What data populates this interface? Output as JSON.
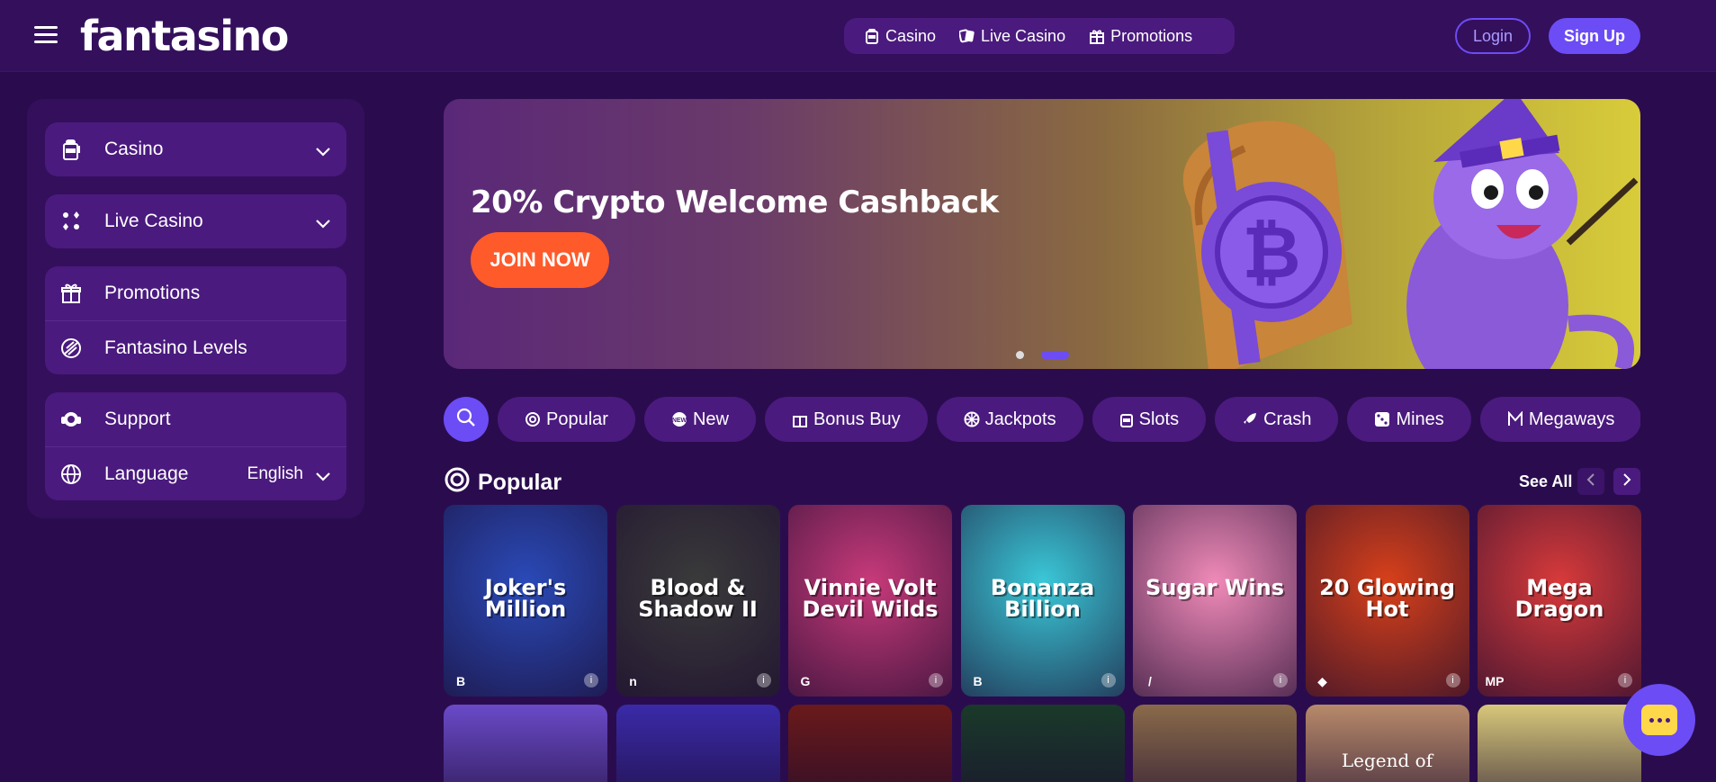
{
  "header": {
    "logo": "fantasino",
    "nav": [
      {
        "label": "Casino",
        "icon": "slot-machine-icon"
      },
      {
        "label": "Live Casino",
        "icon": "cards-icon"
      },
      {
        "label": "Promotions",
        "icon": "gift-icon"
      }
    ],
    "login_label": "Login",
    "signup_label": "Sign Up"
  },
  "sidebar": {
    "casino": "Casino",
    "live_casino": "Live Casino",
    "promotions": "Promotions",
    "levels": "Fantasino Levels",
    "support": "Support",
    "language_label": "Language",
    "language_value": "English"
  },
  "banner": {
    "title": "20% Crypto Welcome Cashback",
    "cta": "JOIN NOW"
  },
  "categories": [
    {
      "label": "Popular",
      "icon": "spiral-icon"
    },
    {
      "label": "New",
      "icon": "new-badge-icon"
    },
    {
      "label": "Bonus Buy",
      "icon": "gift-icon"
    },
    {
      "label": "Jackpots",
      "icon": "wheel-icon"
    },
    {
      "label": "Slots",
      "icon": "slot-machine-icon"
    },
    {
      "label": "Crash",
      "icon": "rocket-icon"
    },
    {
      "label": "Mines",
      "icon": "dice-icon"
    },
    {
      "label": "Megaways",
      "icon": "m-icon"
    }
  ],
  "popular": {
    "title": "Popular",
    "see_all": "See All",
    "games": [
      {
        "name": "Joker's Million",
        "provider": "B",
        "bg": "#2a4ab8"
      },
      {
        "name": "Blood & Shadow II",
        "provider": "n",
        "bg": "#3a3a3a"
      },
      {
        "name": "Vinnie Volt Devil Wilds",
        "provider": "G",
        "bg": "#c83a7a"
      },
      {
        "name": "Bonanza Billion",
        "provider": "B",
        "bg": "#3ac8d8"
      },
      {
        "name": "Sugar Wins",
        "provider": "/",
        "bg": "#f08ab8"
      },
      {
        "name": "20 Glowing Hot",
        "provider": "◆",
        "bg": "#d8401a"
      },
      {
        "name": "Mega Dragon",
        "provider": "MP",
        "bg": "#d83a3a"
      }
    ],
    "row2": [
      {
        "name": "",
        "bg": "#6a4ac8"
      },
      {
        "name": "",
        "bg": "#3a2aa8"
      },
      {
        "name": "",
        "bg": "#6a1a1a"
      },
      {
        "name": "",
        "bg": "#1a3a2a"
      },
      {
        "name": "",
        "bg": "#8a6a4a"
      },
      {
        "name": "Legend of",
        "bg": "#b88a6a"
      },
      {
        "name": "",
        "bg": "#d8c87a"
      }
    ]
  },
  "colors": {
    "accent": "#6c4cf5",
    "cta": "#ff5a2a",
    "bg": "#2a0c4e"
  }
}
